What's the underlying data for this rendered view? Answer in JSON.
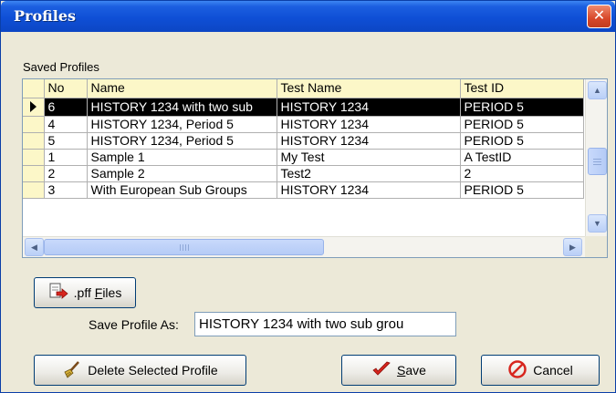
{
  "window": {
    "title": "Profiles",
    "close_glyph": "✕"
  },
  "saved_profiles_label": "Saved Profiles",
  "table": {
    "columns": [
      "No",
      "Name",
      "Test Name",
      "Test ID"
    ],
    "rows": [
      {
        "no": "6",
        "name": "HISTORY 1234 with two sub",
        "test_name": "HISTORY 1234",
        "test_id": "PERIOD 5",
        "selected": true
      },
      {
        "no": "4",
        "name": "HISTORY 1234, Period 5",
        "test_name": "HISTORY 1234",
        "test_id": "PERIOD 5"
      },
      {
        "no": "5",
        "name": "HISTORY 1234, Period 5",
        "test_name": "HISTORY 1234",
        "test_id": "PERIOD 5"
      },
      {
        "no": "1",
        "name": "Sample 1",
        "test_name": "My Test",
        "test_id": "A TestID"
      },
      {
        "no": "2",
        "name": "Sample 2",
        "test_name": "Test2",
        "test_id": "2"
      },
      {
        "no": "3",
        "name": "With European Sub Groups",
        "test_name": "HISTORY 1234",
        "test_id": "PERIOD 5"
      }
    ]
  },
  "buttons": {
    "pff_prefix": ".pff ",
    "pff_hotkey": "F",
    "pff_suffix": "iles",
    "delete": "Delete Selected Profile",
    "save_hotkey": "S",
    "save_suffix": "ave",
    "cancel": "Cancel"
  },
  "save_as": {
    "label": "Save Profile As:",
    "value": "HISTORY 1234 with two sub grou"
  },
  "icons": {
    "close": "close-icon",
    "pff": "file-export-icon",
    "delete": "broom-icon",
    "save": "checkmark-icon",
    "cancel": "no-entry-icon"
  },
  "colors": {
    "selected_row": "#000000",
    "header": "#fcf7c8",
    "titlebar": "#0f4fd6"
  }
}
